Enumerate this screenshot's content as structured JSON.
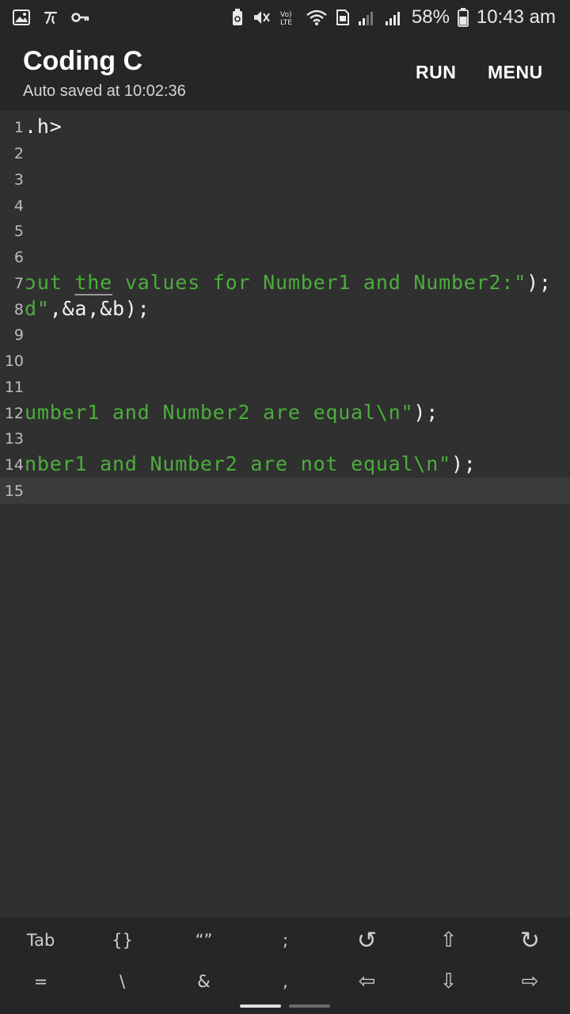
{
  "status_bar": {
    "icons": [
      "gallery-icon",
      "t-icon",
      "key-icon",
      "battery-saver-icon",
      "mute-icon",
      "volte-icon",
      "wifi-icon",
      "sim-icon",
      "signal-icon",
      "signal-icon"
    ],
    "battery": "58%",
    "time": "10:43 am"
  },
  "app_bar": {
    "title": "Coding C",
    "subtitle": "Auto saved at 10:02:36",
    "run_label": "RUN",
    "menu_label": "MENU"
  },
  "editor": {
    "lines": [
      {
        "num": "1",
        "code": ".h>"
      },
      {
        "num": "2",
        "code": ""
      },
      {
        "num": "3",
        "code": ""
      },
      {
        "num": "4",
        "code": ""
      },
      {
        "num": "5",
        "code": ""
      },
      {
        "num": "6",
        "code": ""
      },
      {
        "num": "7",
        "str_a": "ɔut ",
        "str_ul": "the",
        "str_b": " values for Number1 and Number2:\"",
        "code": ");"
      },
      {
        "num": "8",
        "str": "d\"",
        "code": ",&a,&b);"
      },
      {
        "num": "9",
        "code": ""
      },
      {
        "num": "10",
        "code": ""
      },
      {
        "num": "11",
        "code": ""
      },
      {
        "num": "12",
        "str": "umber1 and Number2 are equal\\n\"",
        "code": ");"
      },
      {
        "num": "13",
        "code": ""
      },
      {
        "num": "14",
        "str": "nber1 and Number2 are not equal\\n\"",
        "code": ");"
      },
      {
        "num": "15",
        "code": ""
      }
    ],
    "current_line": "15"
  },
  "keyboard": {
    "row1": [
      "Tab",
      "{}",
      "“”",
      ";",
      "↺",
      "⇧",
      "↻"
    ],
    "row2": [
      "=",
      "\\",
      "&",
      ",",
      "⇦",
      "⇩",
      "⇨"
    ]
  },
  "colors": {
    "string": "#4cae3c",
    "background": "#303030",
    "bar": "#262626"
  }
}
